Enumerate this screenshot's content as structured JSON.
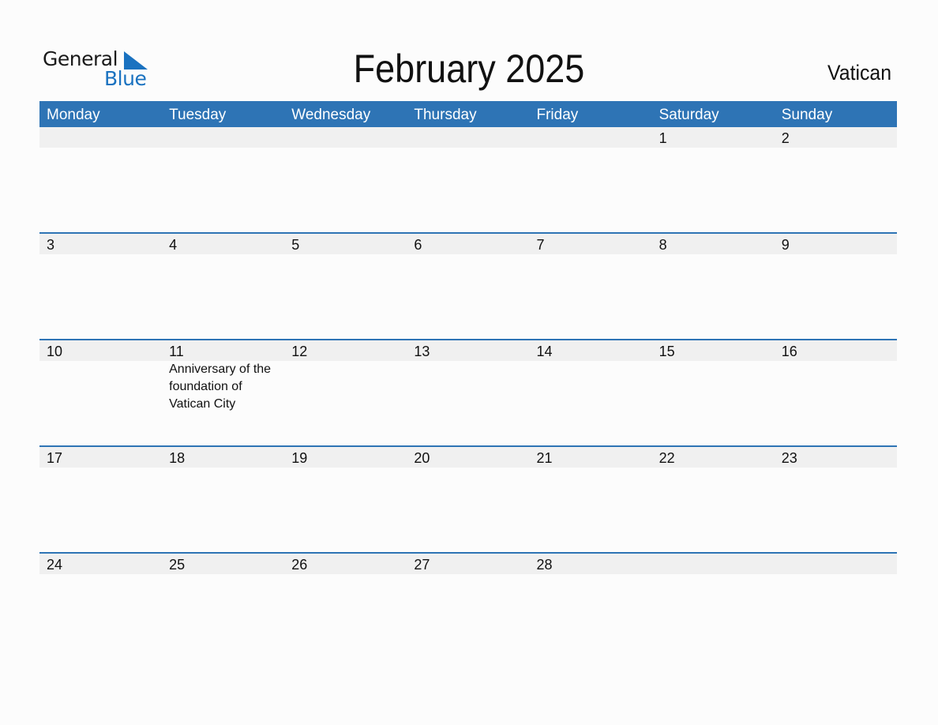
{
  "logo": {
    "general": "General",
    "blue": "Blue"
  },
  "title": "February 2025",
  "country": "Vatican",
  "colors": {
    "accent": "#2e74b5",
    "band": "#f0f0f0",
    "logo_blue": "#1a72c0"
  },
  "weekdays": [
    "Monday",
    "Tuesday",
    "Wednesday",
    "Thursday",
    "Friday",
    "Saturday",
    "Sunday"
  ],
  "weeks": [
    {
      "days": [
        {
          "num": "",
          "event": ""
        },
        {
          "num": "",
          "event": ""
        },
        {
          "num": "",
          "event": ""
        },
        {
          "num": "",
          "event": ""
        },
        {
          "num": "",
          "event": ""
        },
        {
          "num": "1",
          "event": ""
        },
        {
          "num": "2",
          "event": ""
        }
      ]
    },
    {
      "days": [
        {
          "num": "3",
          "event": ""
        },
        {
          "num": "4",
          "event": ""
        },
        {
          "num": "5",
          "event": ""
        },
        {
          "num": "6",
          "event": ""
        },
        {
          "num": "7",
          "event": ""
        },
        {
          "num": "8",
          "event": ""
        },
        {
          "num": "9",
          "event": ""
        }
      ]
    },
    {
      "days": [
        {
          "num": "10",
          "event": ""
        },
        {
          "num": "11",
          "event": "Anniversary of the foundation of Vatican City"
        },
        {
          "num": "12",
          "event": ""
        },
        {
          "num": "13",
          "event": ""
        },
        {
          "num": "14",
          "event": ""
        },
        {
          "num": "15",
          "event": ""
        },
        {
          "num": "16",
          "event": ""
        }
      ]
    },
    {
      "days": [
        {
          "num": "17",
          "event": ""
        },
        {
          "num": "18",
          "event": ""
        },
        {
          "num": "19",
          "event": ""
        },
        {
          "num": "20",
          "event": ""
        },
        {
          "num": "21",
          "event": ""
        },
        {
          "num": "22",
          "event": ""
        },
        {
          "num": "23",
          "event": ""
        }
      ]
    },
    {
      "days": [
        {
          "num": "24",
          "event": ""
        },
        {
          "num": "25",
          "event": ""
        },
        {
          "num": "26",
          "event": ""
        },
        {
          "num": "27",
          "event": ""
        },
        {
          "num": "28",
          "event": ""
        },
        {
          "num": "",
          "event": ""
        },
        {
          "num": "",
          "event": ""
        }
      ]
    }
  ]
}
